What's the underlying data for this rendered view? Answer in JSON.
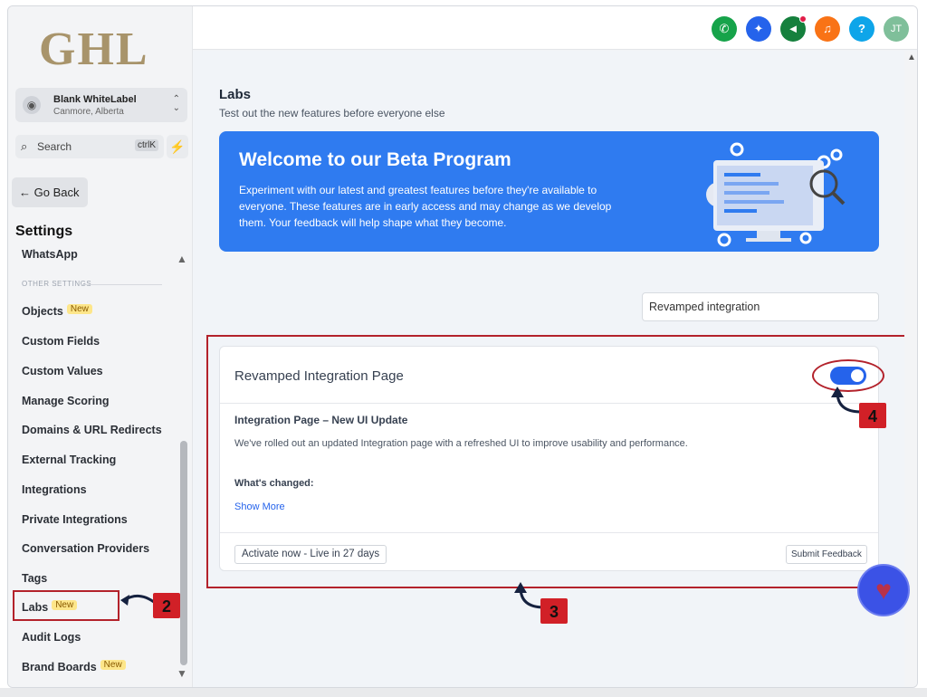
{
  "sidebar": {
    "logo": "GHL",
    "account": {
      "name": "Blank WhiteLabel",
      "location": "Canmore, Alberta"
    },
    "search": {
      "placeholder": "Search",
      "shortcut": "ctrlK"
    },
    "go_back": "Go Back",
    "settings_title": "Settings",
    "section_other": "OTHER SETTINGS",
    "items": [
      {
        "label": "WhatsApp"
      },
      {
        "label": "Objects",
        "badge": "New"
      },
      {
        "label": "Custom Fields"
      },
      {
        "label": "Custom Values"
      },
      {
        "label": "Manage Scoring"
      },
      {
        "label": "Domains & URL Redirects"
      },
      {
        "label": "External Tracking"
      },
      {
        "label": "Integrations"
      },
      {
        "label": "Private Integrations"
      },
      {
        "label": "Conversation Providers"
      },
      {
        "label": "Tags"
      },
      {
        "label": "Labs",
        "badge": "New",
        "active": true
      },
      {
        "label": "Audit Logs"
      },
      {
        "label": "Brand Boards",
        "badge": "New"
      }
    ]
  },
  "topbar": {
    "buttons": [
      {
        "icon": "phone-icon",
        "color": "#16a34a",
        "glyph": "✆"
      },
      {
        "icon": "magic-icon",
        "color": "#2563eb",
        "glyph": "✦"
      },
      {
        "icon": "megaphone-icon",
        "color": "#15803d",
        "glyph": "📢"
      },
      {
        "icon": "bell-icon",
        "color": "#f97316",
        "glyph": "🔔"
      },
      {
        "icon": "help-icon",
        "color": "#0ea5e9",
        "glyph": "?"
      },
      {
        "icon": "avatar",
        "color": "#7fbf9a",
        "glyph": "JT"
      }
    ]
  },
  "main": {
    "title": "Labs",
    "subtitle": "Test out the new features before everyone else",
    "banner": {
      "title": "Welcome to our Beta Program",
      "text": "Experiment with our latest and greatest features before they're available to everyone. These features are in early access and may change as we develop them. Your feedback will help shape what they become."
    },
    "filter_value": "Revamped integration",
    "card": {
      "title": "Revamped Integration Page",
      "enabled": true,
      "subtitle": "Integration Page – New UI Update",
      "description": "We've rolled out an updated Integration page with a refreshed UI to improve usability and performance.",
      "changed_label": "What's changed:",
      "show_more": "Show More",
      "activate_label": "Activate now - Live in 27 days",
      "feedback_label": "Submit Feedback"
    }
  },
  "annotations": {
    "step2": "2",
    "step3": "3",
    "step4": "4"
  },
  "colors": {
    "accent": "#2f7bf0",
    "highlight": "#b3222b",
    "badge": "#fde68a"
  }
}
